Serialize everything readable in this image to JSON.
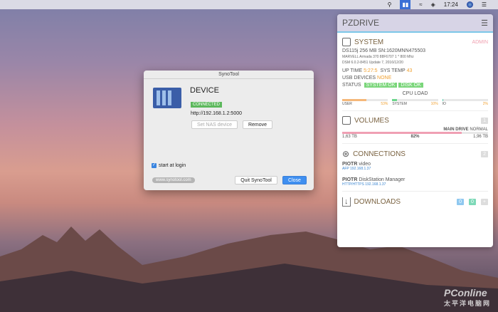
{
  "menubar": {
    "time": "17:24"
  },
  "panel": {
    "title": "PZDRIVE",
    "system": {
      "title": "SYSTEM",
      "role": "ADMIN",
      "model": "DS115j 256 MB SN:1620MNN475503",
      "cpu": "MARVELL Armada 370 88F6707 1 * 800 Mhz",
      "dsm": "DSM 6.0.2-8451 Update 7, 2016/12/20",
      "uptime_label": "UP TIME",
      "uptime": "5:27:5",
      "temp_label": "SYS TEMP",
      "temp": "43",
      "usb_label": "USB DEVICES",
      "usb": "NONE",
      "status_label": "STATUS",
      "status1": "SYSTEM OK",
      "status2": "DISK OK",
      "cpu_title": "CPU LOAD",
      "loads": [
        {
          "name": "USER",
          "value": "53%",
          "pct": 53,
          "color": "#f5b87a"
        },
        {
          "name": "SYSTEM",
          "value": "10%",
          "pct": 10,
          "color": "#6cd68c"
        },
        {
          "name": "IO",
          "value": "2%",
          "pct": 2,
          "color": "#5ccfb0"
        }
      ]
    },
    "volumes": {
      "title": "VOLUMES",
      "count": "1",
      "drive": "MAIN DRIVE",
      "state": "NORMAL",
      "used": "1,63 TB",
      "pct_label": "82%",
      "pct": 82,
      "total": "1,96 TB"
    },
    "connections": {
      "title": "CONNECTIONS",
      "count": "2",
      "items": [
        {
          "user": "PIOTR",
          "app": "video",
          "proto": "AFP",
          "ip": "192.168.1.37"
        },
        {
          "user": "PIOTR",
          "app": "DiskStation Manager",
          "proto": "HTTP/HTTPS",
          "ip": "192.168.1.37"
        }
      ]
    },
    "downloads": {
      "title": "DOWNLOADS",
      "a": "0",
      "b": "0",
      "add": "+"
    }
  },
  "dialog": {
    "title": "SynoTool",
    "device": "DEVICE",
    "status": "CONNECTED",
    "url": "http://192.168.1.2:5000",
    "set": "Set NAS device",
    "remove": "Remove",
    "login": "start at login",
    "site": "www.synotool.com",
    "quit": "Quit SynoTool",
    "close": "Close"
  },
  "watermark": "PConline 太平洋电脑网"
}
